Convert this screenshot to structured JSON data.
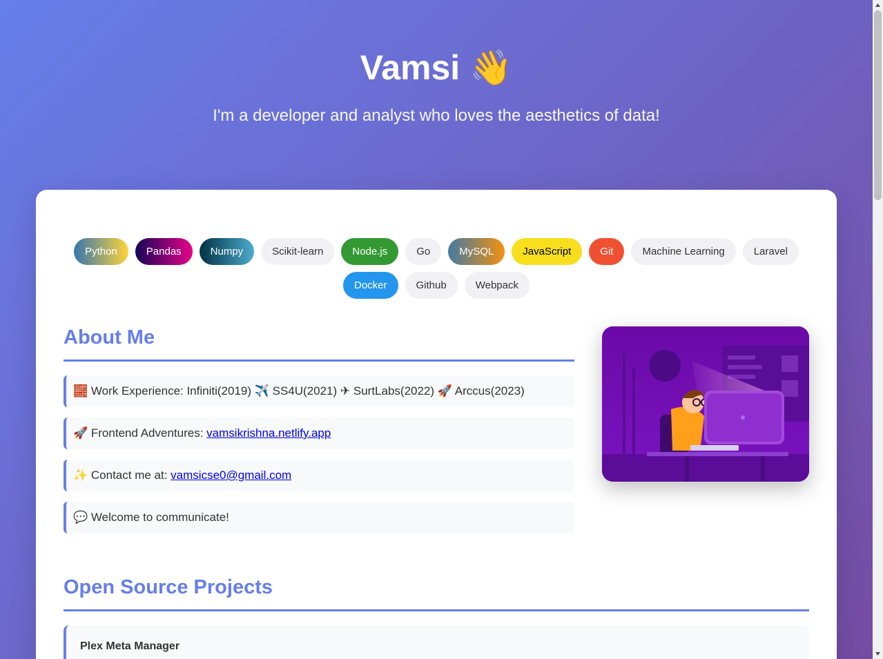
{
  "hero": {
    "name": "Vamsi 👋",
    "tagline": "I'm a developer and analyst who loves the aesthetics of data!"
  },
  "skills": [
    {
      "label": "Python",
      "bg": "linear-gradient(90deg,#3776ab,#ffd43b)",
      "fg": "#ffffff"
    },
    {
      "label": "Pandas",
      "bg": "linear-gradient(90deg,#150458,#e70488)",
      "fg": "#ffffff"
    },
    {
      "label": "Numpy",
      "bg": "linear-gradient(90deg,#013243,#4dabcf)",
      "fg": "#ffffff"
    },
    {
      "label": "Scikit-learn",
      "bg": "#f1f1f3",
      "fg": "#333333"
    },
    {
      "label": "Node.js",
      "bg": "#339933",
      "fg": "#ffffff"
    },
    {
      "label": "Go",
      "bg": "#f1f1f3",
      "fg": "#333333"
    },
    {
      "label": "MySQL",
      "bg": "linear-gradient(90deg,#4479a1,#f29111)",
      "fg": "#ffffff"
    },
    {
      "label": "JavaScript",
      "bg": "#f7df1e",
      "fg": "#000000"
    },
    {
      "label": "Git",
      "bg": "#f05032",
      "fg": "#ffffff"
    },
    {
      "label": "Machine Learning",
      "bg": "#f1f1f3",
      "fg": "#333333"
    },
    {
      "label": "Laravel",
      "bg": "#f1f1f3",
      "fg": "#333333"
    },
    {
      "label": "Docker",
      "bg": "#2496ed",
      "fg": "#ffffff"
    },
    {
      "label": "Github",
      "bg": "#f1f1f3",
      "fg": "#333333"
    },
    {
      "label": "Webpack",
      "bg": "#f1f1f3",
      "fg": "#333333"
    }
  ],
  "about": {
    "title": "About Me",
    "work": "🧱 Work Experience: Infiniti(2019) ✈️ SS4U(2021) ✈ SurtLabs(2022) 🚀 Arccus(2023)",
    "frontend_prefix": "🚀 Frontend Adventures: ",
    "frontend_link": "vamsikrishna.netlify.app",
    "contact_prefix": "✨ Contact me at: ",
    "contact_link": "vamsicse0@gmail.com",
    "welcome": "💬 Welcome to communicate!"
  },
  "projects": {
    "title": "Open Source Projects",
    "items": [
      {
        "name": "Plex Meta Manager"
      }
    ]
  },
  "colors": {
    "accent": "#667eea",
    "gradient_end": "#764ba2"
  }
}
